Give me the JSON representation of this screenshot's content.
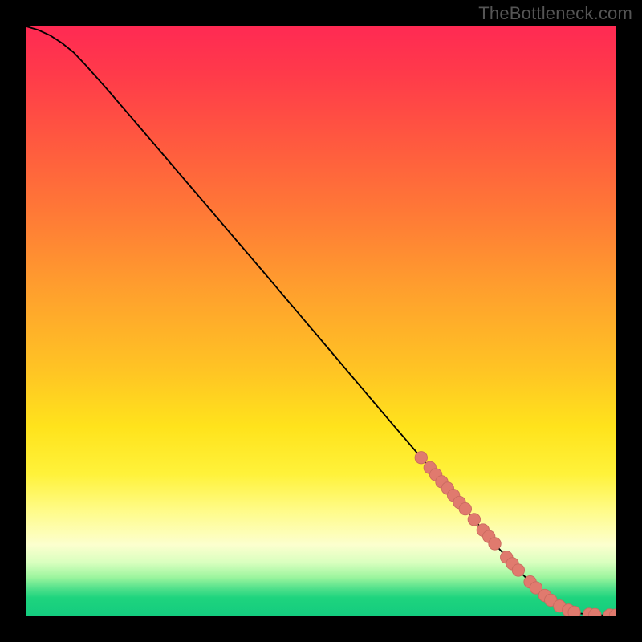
{
  "watermark": "TheBottleneck.com",
  "colors": {
    "curve": "#000000",
    "marker_fill": "#e07a6e",
    "marker_stroke": "#c96a5f",
    "background": "#000000"
  },
  "chart_data": {
    "type": "line",
    "title": "",
    "xlabel": "",
    "ylabel": "",
    "xlim": [
      0,
      100
    ],
    "ylim": [
      0,
      100
    ],
    "grid": false,
    "series": [
      {
        "name": "curve",
        "x": [
          0,
          2,
          4,
          6,
          8,
          10,
          14,
          20,
          30,
          40,
          50,
          60,
          70,
          80,
          84,
          86,
          88,
          90,
          92,
          94,
          96,
          98,
          100
        ],
        "y": [
          100,
          99.4,
          98.5,
          97.2,
          95.6,
          93.5,
          89.0,
          82.0,
          70.3,
          58.6,
          46.8,
          35.0,
          23.3,
          11.6,
          7.2,
          5.2,
          3.4,
          1.9,
          0.9,
          0.35,
          0.12,
          0.05,
          0.04
        ]
      }
    ],
    "markers": [
      {
        "x": 67,
        "y": 26.8
      },
      {
        "x": 68.5,
        "y": 25.1
      },
      {
        "x": 69.5,
        "y": 23.9
      },
      {
        "x": 70.5,
        "y": 22.7
      },
      {
        "x": 71.5,
        "y": 21.6
      },
      {
        "x": 72.5,
        "y": 20.4
      },
      {
        "x": 73.5,
        "y": 19.2
      },
      {
        "x": 74.5,
        "y": 18.1
      },
      {
        "x": 76.0,
        "y": 16.3
      },
      {
        "x": 77.5,
        "y": 14.5
      },
      {
        "x": 78.5,
        "y": 13.4
      },
      {
        "x": 79.5,
        "y": 12.2
      },
      {
        "x": 81.5,
        "y": 9.9
      },
      {
        "x": 82.5,
        "y": 8.8
      },
      {
        "x": 83.5,
        "y": 7.7
      },
      {
        "x": 85.5,
        "y": 5.7
      },
      {
        "x": 86.5,
        "y": 4.7
      },
      {
        "x": 88.0,
        "y": 3.4
      },
      {
        "x": 89.0,
        "y": 2.6
      },
      {
        "x": 90.5,
        "y": 1.6
      },
      {
        "x": 92.0,
        "y": 0.9
      },
      {
        "x": 93.0,
        "y": 0.55
      },
      {
        "x": 95.5,
        "y": 0.2
      },
      {
        "x": 96.5,
        "y": 0.15
      },
      {
        "x": 99.0,
        "y": 0.07
      },
      {
        "x": 100.0,
        "y": 0.04
      }
    ],
    "marker_radius": 1.05
  }
}
